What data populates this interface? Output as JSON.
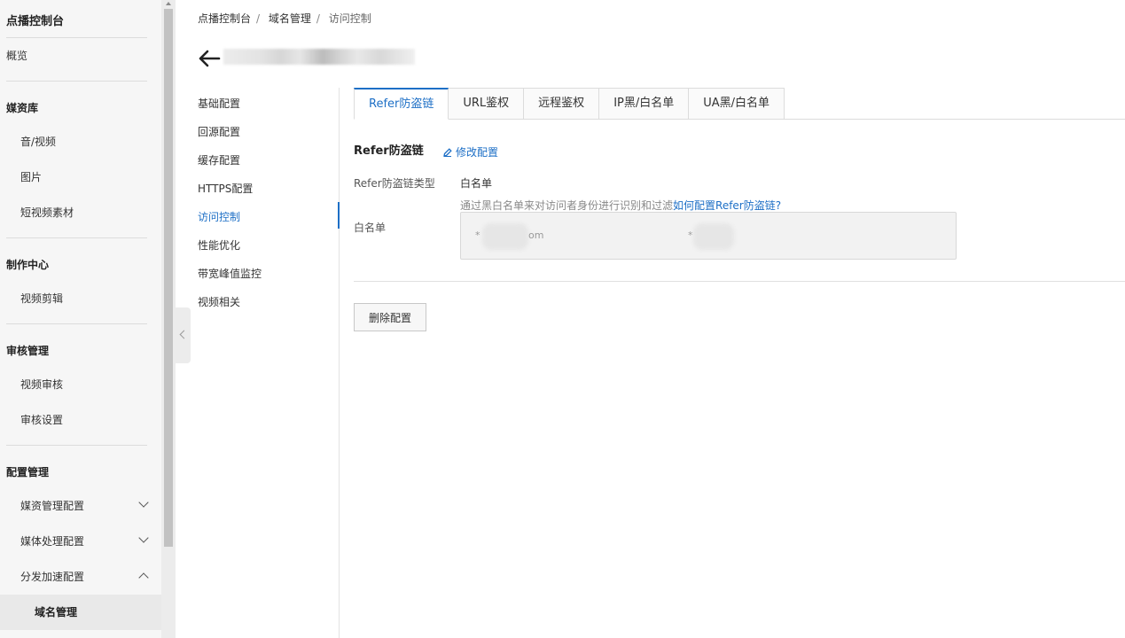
{
  "sidebar": {
    "title": "点播控制台",
    "overview": "概览",
    "groups": {
      "media": {
        "label": "媒资库",
        "items": [
          "音/视频",
          "图片",
          "短视频素材"
        ]
      },
      "production": {
        "label": "制作中心",
        "items": [
          "视频剪辑"
        ]
      },
      "review": {
        "label": "审核管理",
        "items": [
          "视频审核",
          "审核设置"
        ]
      },
      "config": {
        "label": "配置管理",
        "items": [
          "媒资管理配置",
          "媒体处理配置",
          "分发加速配置"
        ],
        "active_sub": "域名管理"
      }
    }
  },
  "breadcrumb": [
    "点播控制台",
    "域名管理",
    "访问控制"
  ],
  "domain_name": "",
  "subnav": [
    "基础配置",
    "回源配置",
    "缓存配置",
    "HTTPS配置",
    "访问控制",
    "性能优化",
    "带宽峰值监控",
    "视频相关"
  ],
  "subnav_active": "访问控制",
  "tabs": [
    "Refer防盗链",
    "URL鉴权",
    "远程鉴权",
    "IP黑/白名单",
    "UA黑/白名单"
  ],
  "active_tab": "Refer防盗链",
  "section": {
    "title": "Refer防盗链",
    "edit_label": "修改配置",
    "type_label": "Refer防盗链类型",
    "type_value": "白名单",
    "hint_text": "通过黑白名单来对访问者身份进行识别和过滤",
    "hint_link": "如何配置Refer防盗链?",
    "whitelist_label": "白名单",
    "whitelist_entries": [
      "*",
      "om",
      "*"
    ]
  },
  "delete_label": "删除配置",
  "colors": {
    "accent": "#1d6fc6",
    "sidebar_bg": "#f6f6f6"
  }
}
